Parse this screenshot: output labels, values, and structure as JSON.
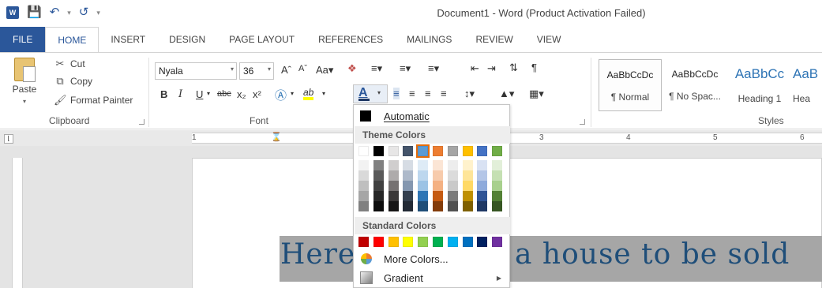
{
  "titlebar": {
    "title": "Document1 - Word (Product Activation Failed)",
    "app_badge": "W"
  },
  "tabs": [
    "FILE",
    "HOME",
    "INSERT",
    "DESIGN",
    "PAGE LAYOUT",
    "REFERENCES",
    "MAILINGS",
    "REVIEW",
    "VIEW"
  ],
  "clipboard": {
    "paste": "Paste",
    "cut": "Cut",
    "copy": "Copy",
    "format_painter": "Format Painter",
    "group": "Clipboard"
  },
  "font": {
    "name": "Nyala",
    "size": "36",
    "group": "Font",
    "font_color_glyph": "A"
  },
  "styles": {
    "group": "Styles",
    "items": [
      {
        "sample": "AaBbCcDc",
        "name": "¶ Normal"
      },
      {
        "sample": "AaBbCcDc",
        "name": "¶ No Spac..."
      },
      {
        "sample": "AaBbCc",
        "name": "Heading 1"
      },
      {
        "sample": "AaB",
        "name": "Hea"
      }
    ]
  },
  "ruler": {
    "numbers": [
      "1",
      "3",
      "4",
      "5",
      "6"
    ]
  },
  "document": {
    "text": "Here         a house to be sold",
    "text_left": "Here",
    "text_right": "a house to be sold"
  },
  "dropdown": {
    "automatic": "Automatic",
    "theme_colors": "Theme Colors",
    "standard_colors": "Standard Colors",
    "more_colors": "More Colors...",
    "gradient": "Gradient",
    "theme_top": [
      "#ffffff",
      "#000000",
      "#e7e6e6",
      "#44546a",
      "#5b9bd5",
      "#ed7d31",
      "#a5a5a5",
      "#ffc000",
      "#4472c4",
      "#70ad47"
    ],
    "theme_shades": [
      [
        "#f2f2f2",
        "#d9d9d9",
        "#bfbfbf",
        "#a6a6a6",
        "#808080"
      ],
      [
        "#808080",
        "#595959",
        "#404040",
        "#262626",
        "#0d0d0d"
      ],
      [
        "#d0cece",
        "#aeabab",
        "#757171",
        "#3a3838",
        "#171616"
      ],
      [
        "#d6dce4",
        "#adb9ca",
        "#8497b0",
        "#333f4f",
        "#222a35"
      ],
      [
        "#deebf6",
        "#bdd7ee",
        "#9cc3e5",
        "#2e75b5",
        "#1f4e79"
      ],
      [
        "#fbe5d5",
        "#f7cbac",
        "#f4b183",
        "#c55a11",
        "#833c0b"
      ],
      [
        "#ededed",
        "#dbdbdb",
        "#c9c9c9",
        "#7b7b7b",
        "#525252"
      ],
      [
        "#fff2cc",
        "#fee599",
        "#ffd965",
        "#bf9000",
        "#7f6000"
      ],
      [
        "#d9e2f3",
        "#b4c6e7",
        "#8eaadb",
        "#2f5496",
        "#1f3864"
      ],
      [
        "#e2efd9",
        "#c5e0b3",
        "#a8d08d",
        "#538135",
        "#375623"
      ]
    ],
    "standard": [
      "#c00000",
      "#ff0000",
      "#ffc000",
      "#ffff00",
      "#92d050",
      "#00b050",
      "#00b0f0",
      "#0070c0",
      "#002060",
      "#7030a0"
    ],
    "selected_index": 4
  }
}
